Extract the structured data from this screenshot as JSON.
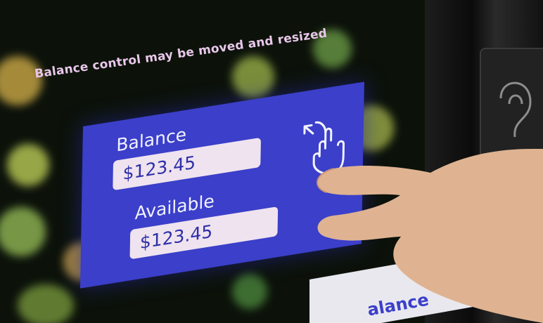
{
  "hint_text": "Balance control may be moved and resized",
  "balance_label": "Balance",
  "balance_value": "$123.45",
  "available_label": "Available",
  "available_value": "$123.45",
  "partial_bottom_text": "alance",
  "colors": {
    "panel": "#3b3fc9",
    "field": "#efe3ef",
    "field_text": "#2d2fa8",
    "hint": "#e9c7ea",
    "background": "#0c120a"
  }
}
